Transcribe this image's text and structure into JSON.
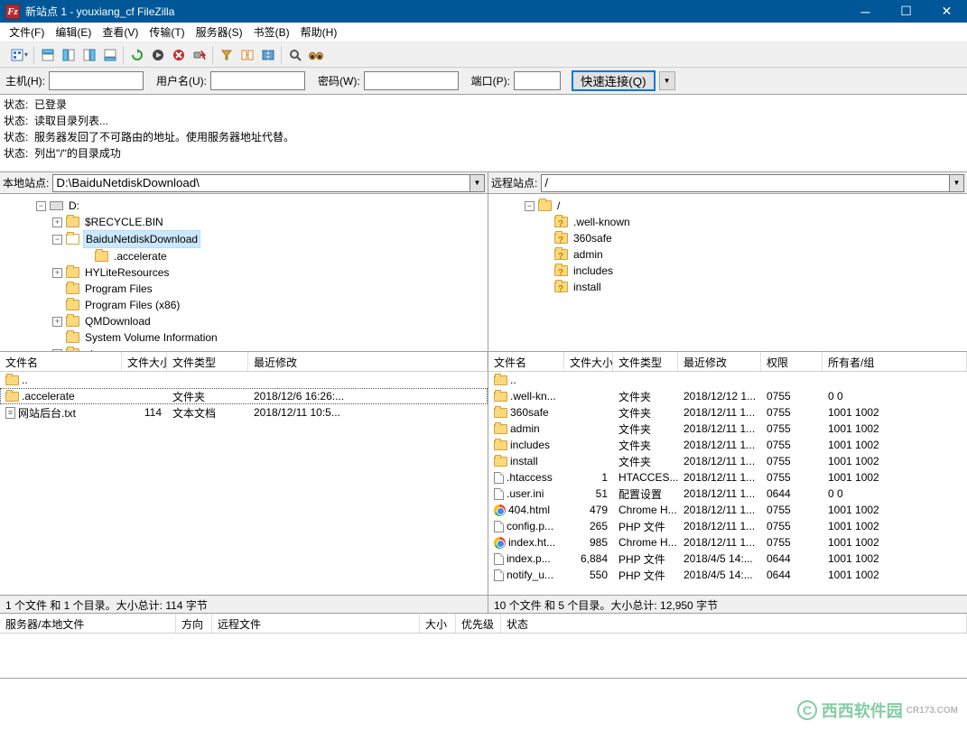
{
  "title_bar": {
    "text": "新站点 1 - youxiang_cf                   FileZilla"
  },
  "menu": {
    "file": "文件(F)",
    "edit": "编辑(E)",
    "view": "查看(V)",
    "transfer": "传输(T)",
    "server": "服务器(S)",
    "bookmarks": "书签(B)",
    "help": "帮助(H)"
  },
  "quickconnect": {
    "host_label": "主机(H):",
    "host": "",
    "user_label": "用户名(U):",
    "user": "",
    "pass_label": "密码(W):",
    "pass": "",
    "port_label": "端口(P):",
    "port": "",
    "button": "快速连接(Q)"
  },
  "log": {
    "prefix": "状态:",
    "lines": [
      "已登录",
      "读取目录列表...",
      "服务器发回了不可路由的地址。使用服务器地址代替。",
      "列出\"/\"的目录成功"
    ]
  },
  "local": {
    "path_label": "本地站点:",
    "path": "D:\\BaiduNetdiskDownload\\",
    "tree": [
      {
        "indent": 40,
        "exp": "-",
        "icon": "drive",
        "label": "D:"
      },
      {
        "indent": 58,
        "exp": "+",
        "icon": "fld",
        "label": "$RECYCLE.BIN"
      },
      {
        "indent": 58,
        "exp": "-",
        "icon": "fld-open",
        "label": "BaiduNetdiskDownload",
        "selected": true
      },
      {
        "indent": 90,
        "exp": "",
        "icon": "fld",
        "label": ".accelerate"
      },
      {
        "indent": 58,
        "exp": "+",
        "icon": "fld",
        "label": "HYLiteResources"
      },
      {
        "indent": 58,
        "exp": "",
        "icon": "fld",
        "label": "Program Files"
      },
      {
        "indent": 58,
        "exp": "",
        "icon": "fld",
        "label": "Program Files (x86)"
      },
      {
        "indent": 58,
        "exp": "+",
        "icon": "fld",
        "label": "QMDownload"
      },
      {
        "indent": 58,
        "exp": "",
        "icon": "fld",
        "label": "System Volume Information"
      },
      {
        "indent": 58,
        "exp": "+",
        "icon": "fld",
        "label": "yto"
      }
    ],
    "cols": {
      "name": "文件名",
      "size": "文件大小",
      "type": "文件类型",
      "modified": "最近修改"
    },
    "cols_w": {
      "name": 135,
      "size": 50,
      "type": 90,
      "modified": 260
    },
    "files": [
      {
        "icon": "fld",
        "name": "..",
        "size": "",
        "type": "",
        "modified": ""
      },
      {
        "icon": "fld",
        "name": ".accelerate",
        "size": "",
        "type": "文件夹",
        "modified": "2018/12/6 16:26:...",
        "focused": true
      },
      {
        "icon": "txt",
        "name": "网站后台.txt",
        "size": "114",
        "type": "文本文档",
        "modified": "2018/12/11 10:5..."
      }
    ],
    "status": "1 个文件 和 1 个目录。大小总计: 114 字节"
  },
  "remote": {
    "path_label": "远程站点:",
    "path": "/",
    "tree": [
      {
        "indent": 40,
        "exp": "-",
        "icon": "fld",
        "label": "/"
      },
      {
        "indent": 58,
        "exp": "",
        "icon": "fld-q",
        "label": ".well-known"
      },
      {
        "indent": 58,
        "exp": "",
        "icon": "fld-q",
        "label": "360safe"
      },
      {
        "indent": 58,
        "exp": "",
        "icon": "fld-q",
        "label": "admin"
      },
      {
        "indent": 58,
        "exp": "",
        "icon": "fld-q",
        "label": "includes"
      },
      {
        "indent": 58,
        "exp": "",
        "icon": "fld-q",
        "label": "install"
      }
    ],
    "cols": {
      "name": "文件名",
      "size": "文件大小",
      "type": "文件类型",
      "modified": "最近修改",
      "perm": "权限",
      "owner": "所有者/组"
    },
    "cols_w": {
      "name": 84,
      "size": 54,
      "type": 72,
      "modified": 92,
      "perm": 68,
      "owner": 150
    },
    "files": [
      {
        "icon": "fld",
        "name": "..",
        "size": "",
        "type": "",
        "modified": "",
        "perm": "",
        "owner": ""
      },
      {
        "icon": "fld",
        "name": ".well-kn...",
        "size": "",
        "type": "文件夹",
        "modified": "2018/12/12 1...",
        "perm": "0755",
        "owner": "0 0"
      },
      {
        "icon": "fld",
        "name": "360safe",
        "size": "",
        "type": "文件夹",
        "modified": "2018/12/11 1...",
        "perm": "0755",
        "owner": "1001 1002"
      },
      {
        "icon": "fld",
        "name": "admin",
        "size": "",
        "type": "文件夹",
        "modified": "2018/12/11 1...",
        "perm": "0755",
        "owner": "1001 1002"
      },
      {
        "icon": "fld",
        "name": "includes",
        "size": "",
        "type": "文件夹",
        "modified": "2018/12/11 1...",
        "perm": "0755",
        "owner": "1001 1002"
      },
      {
        "icon": "fld",
        "name": "install",
        "size": "",
        "type": "文件夹",
        "modified": "2018/12/11 1...",
        "perm": "0755",
        "owner": "1001 1002"
      },
      {
        "icon": "file",
        "name": ".htaccess",
        "size": "1",
        "type": "HTACCES...",
        "modified": "2018/12/11 1...",
        "perm": "0755",
        "owner": "1001 1002"
      },
      {
        "icon": "file",
        "name": ".user.ini",
        "size": "51",
        "type": "配置设置",
        "modified": "2018/12/11 1...",
        "perm": "0644",
        "owner": "0 0"
      },
      {
        "icon": "chrome",
        "name": "404.html",
        "size": "479",
        "type": "Chrome H...",
        "modified": "2018/12/11 1...",
        "perm": "0755",
        "owner": "1001 1002"
      },
      {
        "icon": "file",
        "name": "config.p...",
        "size": "265",
        "type": "PHP 文件",
        "modified": "2018/12/11 1...",
        "perm": "0755",
        "owner": "1001 1002"
      },
      {
        "icon": "chrome",
        "name": "index.ht...",
        "size": "985",
        "type": "Chrome H...",
        "modified": "2018/12/11 1...",
        "perm": "0755",
        "owner": "1001 1002"
      },
      {
        "icon": "file",
        "name": "index.p...",
        "size": "6,884",
        "type": "PHP 文件",
        "modified": "2018/4/5 14:...",
        "perm": "0644",
        "owner": "1001 1002"
      },
      {
        "icon": "file",
        "name": "notify_u...",
        "size": "550",
        "type": "PHP 文件",
        "modified": "2018/4/5 14:...",
        "perm": "0644",
        "owner": "1001 1002"
      }
    ],
    "status": "10 个文件 和 5 个目录。大小总计: 12,950 字节"
  },
  "queue": {
    "cols": {
      "server": "服务器/本地文件",
      "direction": "方向",
      "remote": "远程文件",
      "size": "大小",
      "priority": "优先级",
      "status": "状态"
    }
  },
  "watermark": "西西软件园"
}
